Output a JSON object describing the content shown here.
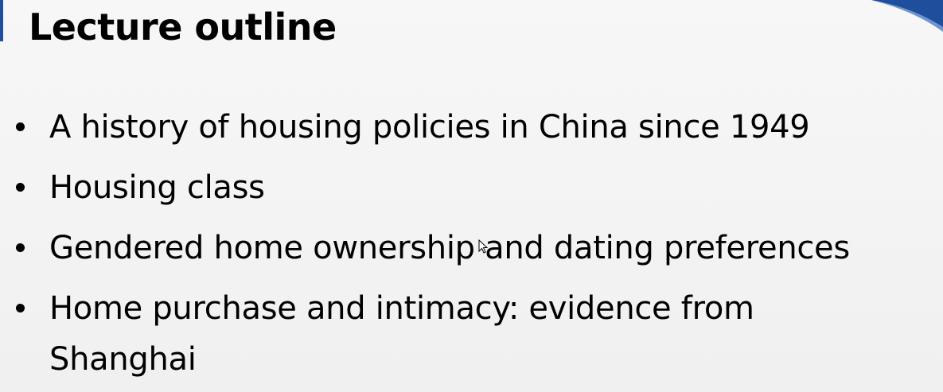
{
  "slide": {
    "title": "Lecture outline",
    "bullets": [
      "A history of housing policies in China since 1949",
      "Housing class",
      "Gendered home ownership and dating preferences",
      "Home purchase and intimacy: evidence from Shanghai"
    ]
  },
  "colors": {
    "accent": "#1f4e9c",
    "text": "#000000",
    "background": "#f2f2f2"
  },
  "icons": {
    "cursor": "mouse-pointer-icon"
  }
}
